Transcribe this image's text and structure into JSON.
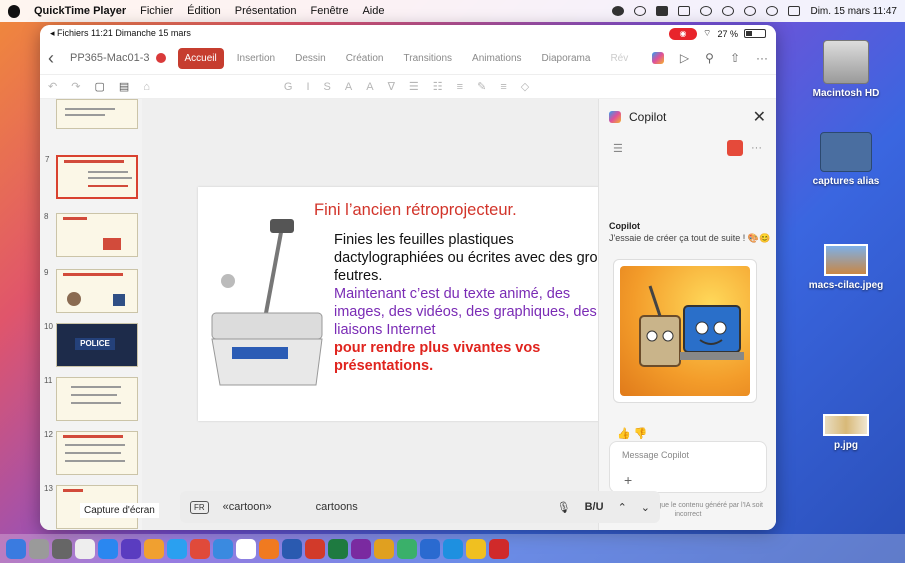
{
  "menubar": {
    "app": "QuickTime Player",
    "items": [
      "Fichier",
      "Édition",
      "Présentation",
      "Fenêtre",
      "Aide"
    ],
    "clock": "Dim. 15 mars 11:47"
  },
  "desktop": {
    "icons": [
      {
        "label": "Macintosh HD"
      },
      {
        "label": "captures alias"
      },
      {
        "label": "macs-cilac.jpeg"
      },
      {
        "label": "p.jpg"
      }
    ]
  },
  "ipad_status": {
    "left": "◂ Fichiers  11:21  Dimanche 15 mars",
    "battery": "27 %"
  },
  "ppt": {
    "doc_name": "PP365-Mac01-3",
    "tabs": [
      "Accueil",
      "Insertion",
      "Dessin",
      "Création",
      "Transitions",
      "Animations",
      "Diaporama",
      "Rév"
    ],
    "active_tab": "Accueil",
    "slide_numbers": [
      "7",
      "8",
      "9",
      "10",
      "11",
      "12",
      "13"
    ],
    "police_label": "POLICE",
    "slide": {
      "title": "Fini l’ancien rétroprojecteur.",
      "line1": "Finies les feuilles plastiques dactylographiées ou écrites avec des gros feutres.",
      "line2": "Maintenant c’est du texte animé, des images, des vidéos, des graphiques, des liaisons Internet",
      "line3": "pour rendre plus vivantes vos présentations."
    }
  },
  "copilot": {
    "title": "Copilot",
    "sender": "Copilot",
    "message": "J'essaie de créer ça tout de suite ! 🎨😊",
    "input_placeholder": "Message Copilot",
    "disclaimer": "Il est possible que le contenu généré par l'IA soit incorrect"
  },
  "autocorrect": {
    "lang": "FR",
    "sugg1": "«cartoon»",
    "sugg2": "cartoons",
    "format": "B/U"
  },
  "capture_label": "Capture d'écran",
  "colors": {
    "accent": "#c63d2f",
    "title_red": "#d2342a",
    "purple": "#7a2bb5"
  }
}
